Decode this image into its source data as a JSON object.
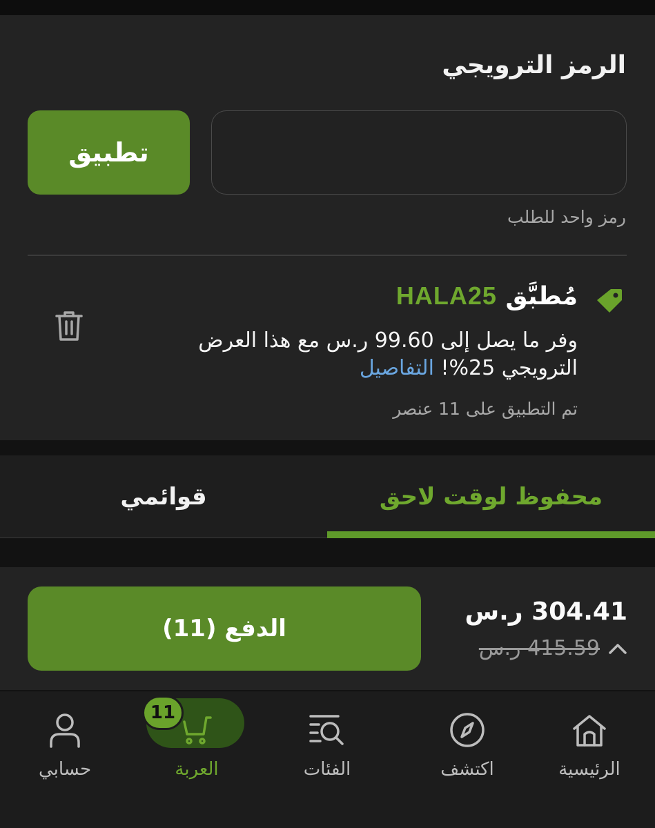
{
  "promo": {
    "title": "الرمز الترويجي",
    "input_value": "",
    "input_placeholder": "",
    "apply_label": "تطبيق",
    "hint": "رمز واحد للطلب",
    "applied_label": "مُطبَّق",
    "applied_code": "HALA25",
    "description": "وفر ما يصل إلى 99.60 ر.س مع هذا العرض الترويجي 25%! ",
    "details_link": "التفاصيل",
    "applied_date": "تم التطبيق على 11 عنصر"
  },
  "tabs": [
    {
      "label": "محفوظ لوقت لاحق",
      "active": true
    },
    {
      "label": "قوائمي",
      "active": false
    }
  ],
  "checkout": {
    "total": "304.41 ر.س",
    "original": "415.59 ر.س",
    "button_label": "الدفع (11)"
  },
  "nav": {
    "home": "الرئيسية",
    "explore": "اكتشف",
    "categories": "الفئات",
    "cart": "العربة",
    "cart_count": "11",
    "account": "حسابي"
  },
  "colors": {
    "accent": "#5a8a28",
    "accent_text": "#6fa82e",
    "link": "#6aa6e0",
    "background": "#232323"
  }
}
